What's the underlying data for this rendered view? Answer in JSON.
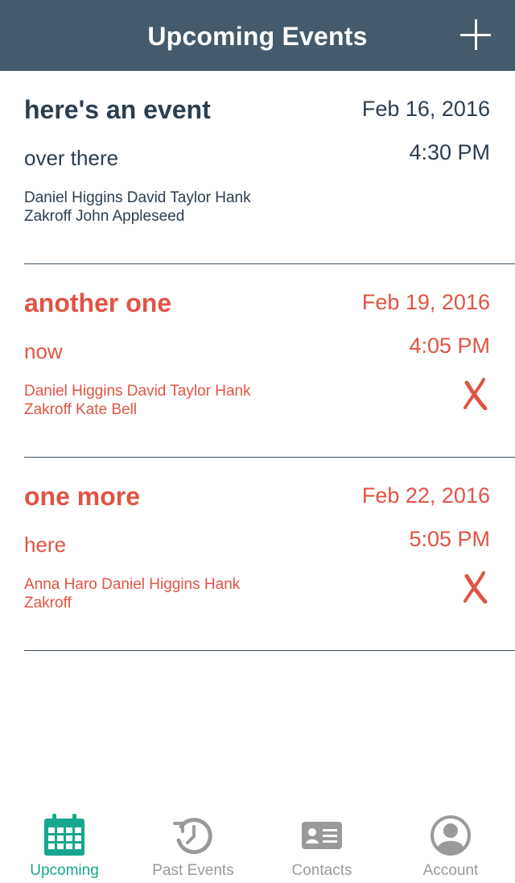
{
  "header": {
    "title": "Upcoming Events"
  },
  "events": [
    {
      "title": "here's an event",
      "location": "over there",
      "attendees": "Daniel Higgins David Taylor Hank Zakroff John Appleseed",
      "date": "Feb 16, 2016",
      "time": "4:30 PM",
      "declined": false
    },
    {
      "title": "another one",
      "location": "now",
      "attendees": "Daniel Higgins David Taylor Hank Zakroff Kate Bell",
      "date": "Feb 19, 2016",
      "time": "4:05 PM",
      "declined": true
    },
    {
      "title": "one more",
      "location": "here",
      "attendees": "Anna Haro Daniel Higgins Hank Zakroff",
      "date": "Feb 22, 2016",
      "time": "5:05 PM",
      "declined": true
    }
  ],
  "tabs": [
    {
      "label": "Upcoming",
      "icon": "calendar-icon",
      "active": true
    },
    {
      "label": "Past Events",
      "icon": "history-icon",
      "active": false
    },
    {
      "label": "Contacts",
      "icon": "contact-card-icon",
      "active": false
    },
    {
      "label": "Account",
      "icon": "account-icon",
      "active": false
    }
  ],
  "colors": {
    "header_bg": "#455a6a",
    "text_dark": "#2c3e50",
    "declined_red": "#e05443",
    "tab_active": "#17a78e",
    "tab_inactive": "#9a9a9a"
  }
}
